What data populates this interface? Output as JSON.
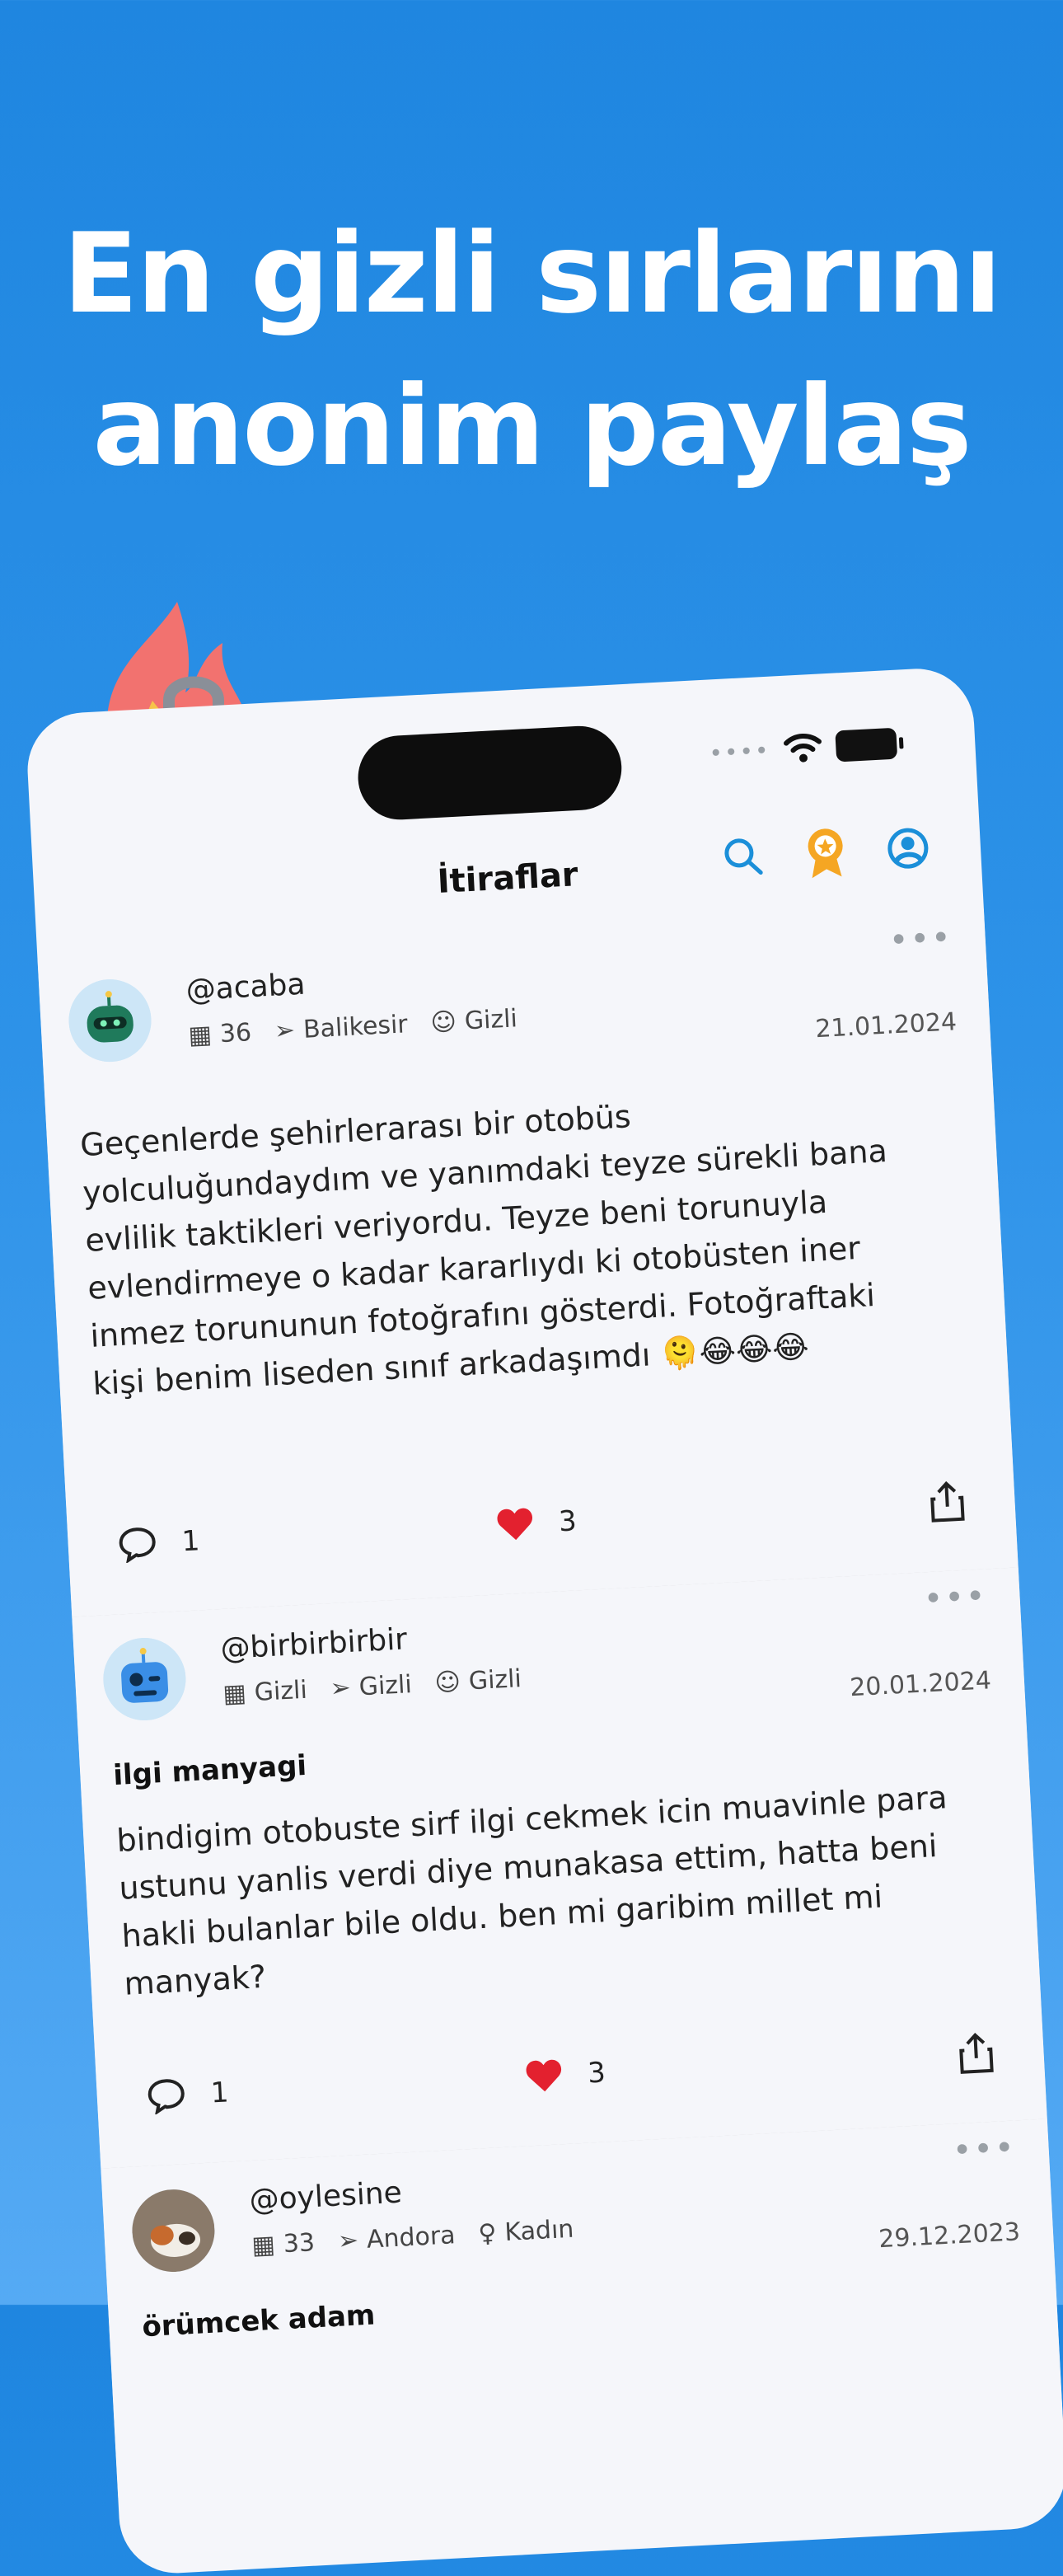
{
  "headline": {
    "line1": "En gizli sırlarını",
    "line2": "anonim paylaş"
  },
  "nav": {
    "title": "İtiraflar",
    "status_dots": "••••"
  },
  "posts": [
    {
      "username": "@acaba",
      "meta": {
        "age": "36",
        "location": "Balikesir",
        "gender": "Gizli"
      },
      "date": "21.01.2024",
      "title": "",
      "body": "Geçenlerde şehirlerarası bir otobüs yolculuğundaydım ve yanımdaki teyze sürekli bana evlilik taktikleri veriyordu. Teyze beni torunuyla evlendirmeye o kadar kararlıydı ki otobüsten iner inmez torununun fotoğrafını gösterdi. Fotoğraftaki kişi benim liseden sınıf arkadaşımdı 🫠😂😂😂",
      "comments": "1",
      "likes": "3"
    },
    {
      "username": "@birbirbirbir",
      "meta": {
        "age": "Gizli",
        "location": "Gizli",
        "gender": "Gizli"
      },
      "date": "20.01.2024",
      "title": "ilgi manyagi",
      "body": "bindigim otobuste sirf ilgi cekmek icin muavinle para ustunu yanlis verdi diye munakasa ettim, hatta beni hakli bulanlar bile oldu. ben mi garibim millet mi manyak?",
      "comments": "1",
      "likes": "3"
    },
    {
      "username": "@oylesine",
      "meta": {
        "age": "33",
        "location": "Andora",
        "gender": "Kadın"
      },
      "date": "29.12.2023",
      "title": "örümcek adam",
      "body": "",
      "comments": "",
      "likes": ""
    }
  ],
  "colors": {
    "accent": "#1b8fd9",
    "badge": "#f5a623",
    "heart": "#e3212f"
  }
}
